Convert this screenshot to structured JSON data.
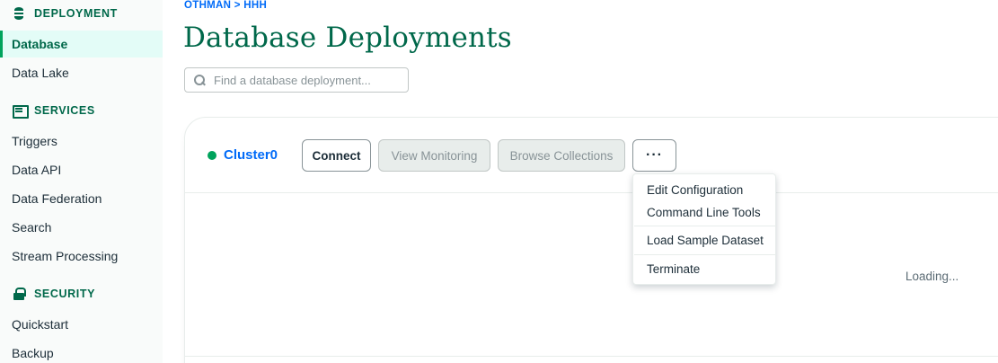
{
  "sidebar": {
    "sections": [
      {
        "label": "DEPLOYMENT",
        "icon": "database-icon"
      },
      {
        "label": "SERVICES",
        "icon": "services-icon"
      },
      {
        "label": "SECURITY",
        "icon": "lock-icon"
      }
    ],
    "deployment_items": [
      {
        "label": "Database",
        "active": true
      },
      {
        "label": "Data Lake"
      }
    ],
    "services_items": [
      {
        "label": "Triggers"
      },
      {
        "label": "Data API"
      },
      {
        "label": "Data Federation"
      },
      {
        "label": "Search"
      },
      {
        "label": "Stream Processing"
      }
    ],
    "security_items": [
      {
        "label": "Quickstart"
      },
      {
        "label": "Backup"
      }
    ]
  },
  "breadcrumb": "OTHMAN > HHH",
  "page_title": "Database Deployments",
  "search": {
    "placeholder": "Find a database deployment...",
    "value": ""
  },
  "cluster": {
    "name": "Cluster0",
    "status_color": "#00a35c",
    "buttons": {
      "connect": "Connect",
      "view_monitoring": "View Monitoring",
      "browse_collections": "Browse Collections",
      "more": "···"
    }
  },
  "menu": {
    "items": [
      "Edit Configuration",
      "Command Line Tools",
      "Load Sample Dataset",
      "Terminate"
    ]
  },
  "loading_text": "Loading..."
}
